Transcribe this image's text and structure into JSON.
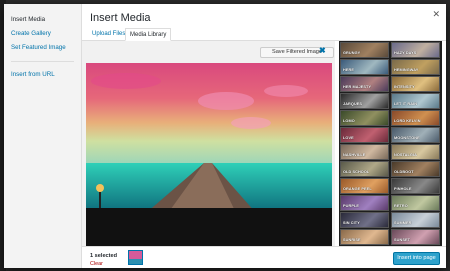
{
  "sidebar": {
    "items": [
      {
        "label": "Insert Media",
        "active": true
      },
      {
        "label": "Create Gallery",
        "active": false
      },
      {
        "label": "Set Featured Image",
        "active": false
      },
      {
        "label": "Insert from URL",
        "active": false
      }
    ]
  },
  "header": {
    "title": "Insert Media",
    "close_icon": "close-icon"
  },
  "tabs": [
    {
      "label": "Upload Files",
      "active": false
    },
    {
      "label": "Media Library",
      "active": true
    }
  ],
  "editor": {
    "save_label": "Save Filtered Image",
    "cancel_icon": "close-icon"
  },
  "filters": [
    "GRUNGY",
    "HAZY DAYS",
    "HERE",
    "HEMINGWAY",
    "HER MAJESTY",
    "INTENSITY",
    "JARQUES",
    "LET IT RAIN",
    "LOMO",
    "LORD KELVIN",
    "LOVE",
    "MOONSTONE",
    "NASHVILLE",
    "NOSTALGIA",
    "OLD SCHOOL",
    "OLDBOOT",
    "ORANGE PEEL",
    "PINHOLE",
    "PURPLE",
    "RETRO",
    "SIN CITY",
    "SUMMER",
    "SUNRISE",
    "SUNSET"
  ],
  "footer": {
    "selected_text": "1 selected",
    "clear_label": "Clear",
    "insert_label": "Insert into page"
  },
  "colors": {
    "accent": "#0073aa",
    "button": "#2ea2cc",
    "clear": "#aa0000"
  }
}
